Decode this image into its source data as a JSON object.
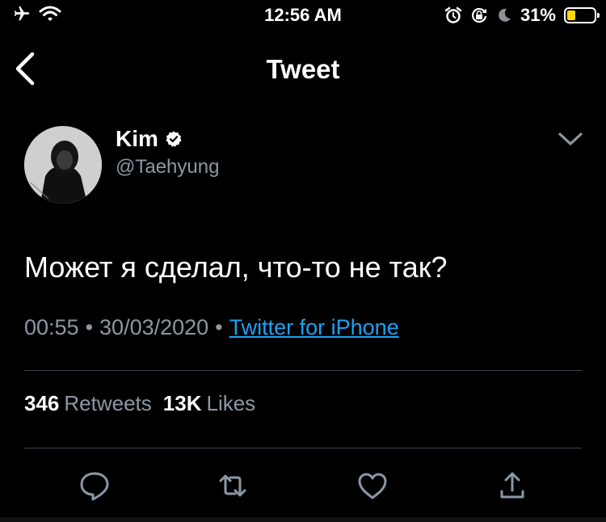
{
  "status_bar": {
    "time": "12:56 AM",
    "battery": "31%",
    "battery_level": 0.31,
    "icons": [
      "airplane-icon",
      "wifi-icon",
      "alarm-icon",
      "orientation-lock-icon",
      "moon-icon",
      "battery-icon"
    ],
    "battery_color": "#ffd60a"
  },
  "nav": {
    "title": "Tweet",
    "back_icon": "chevron-left-icon"
  },
  "tweet": {
    "author_name": "Kim",
    "handle": "@Taehyung",
    "verified": true,
    "text": "Может я сделал, что-то не так?",
    "time": "00:55",
    "date": "30/03/2020",
    "separator": "•",
    "source": "Twitter for iPhone",
    "retweets": "346",
    "retweets_label": "Retweets",
    "likes": "13K",
    "likes_label": "Likes"
  },
  "actions": [
    "reply-icon",
    "retweet-icon",
    "like-icon",
    "share-icon"
  ],
  "colors": {
    "background": "#000000",
    "secondary_text": "#8b98a5",
    "link": "#1da1f2",
    "divider": "#38444d"
  }
}
